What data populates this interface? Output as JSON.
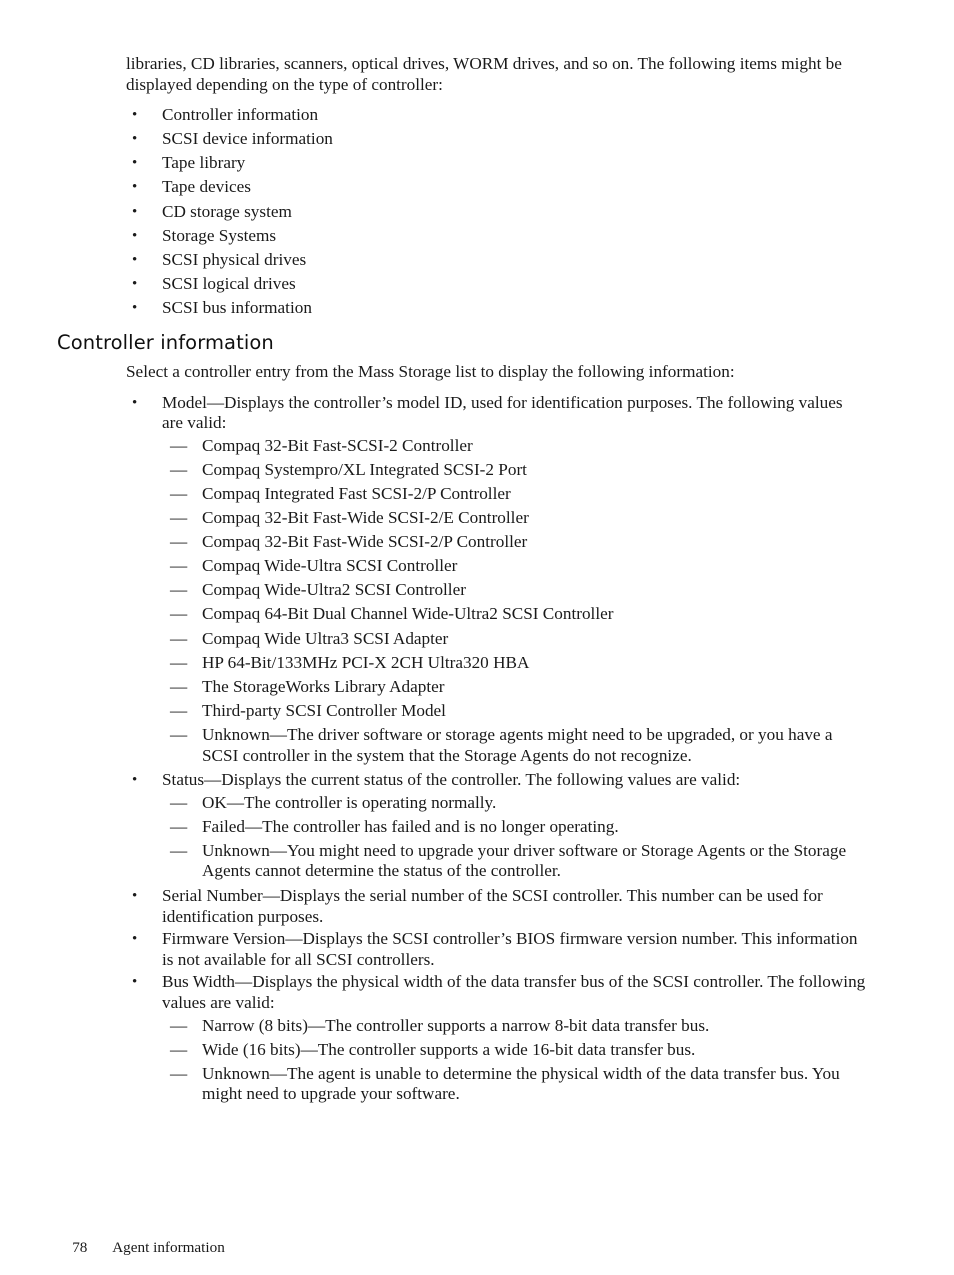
{
  "page": {
    "intro_paragraph": "libraries, CD libraries, scanners, optical drives, WORM drives, and so on. The following items might be displayed depending on the type of controller:",
    "intro_items": [
      "Controller information",
      "SCSI device information",
      "Tape library",
      "Tape devices",
      "CD storage system",
      "Storage Systems",
      "SCSI physical drives",
      "SCSI logical drives",
      "SCSI bus information"
    ],
    "heading": "Controller information",
    "lead_paragraph": "Select a controller entry from the Mass Storage list to display the following information:",
    "bullets": [
      {
        "text": "Model—Displays the controller’s model ID, used for identification purposes. The following values are valid:",
        "subitems": [
          "Compaq 32-Bit Fast-SCSI-2 Controller",
          "Compaq Systempro/XL Integrated SCSI-2 Port",
          "Compaq Integrated Fast SCSI-2/P Controller",
          "Compaq 32-Bit Fast-Wide SCSI-2/E Controller",
          "Compaq 32-Bit Fast-Wide SCSI-2/P Controller",
          "Compaq Wide-Ultra SCSI Controller",
          "Compaq Wide-Ultra2 SCSI Controller",
          "Compaq 64-Bit Dual Channel Wide-Ultra2 SCSI Controller",
          "Compaq Wide Ultra3 SCSI Adapter",
          "HP 64-Bit/133MHz PCI-X 2CH Ultra320 HBA",
          "The StorageWorks Library Adapter",
          "Third-party SCSI Controller Model",
          "Unknown—The driver software or storage agents might need to be upgraded, or you have a SCSI controller in the system that the Storage Agents do not recognize."
        ]
      },
      {
        "text": "Status—Displays the current status of the controller. The following values are valid:",
        "subitems": [
          "OK—The controller is operating normally.",
          "Failed—The controller has failed and is no longer operating.",
          "Unknown—You might need to upgrade your driver software or Storage Agents or the Storage Agents cannot determine the status of the controller."
        ]
      },
      {
        "text": "Serial Number—Displays the serial number of the SCSI controller. This number can be used for identification purposes.",
        "subitems": []
      },
      {
        "text": "Firmware Version—Displays the SCSI controller’s BIOS firmware version number. This information is not available for all SCSI controllers.",
        "subitems": []
      },
      {
        "text": "Bus Width—Displays the physical width of the data transfer bus of the SCSI controller. The following values are valid:",
        "subitems": [
          "Narrow (8 bits)—The controller supports a narrow 8-bit data transfer bus.",
          "Wide (16 bits)—The controller supports a wide 16-bit data transfer bus.",
          "Unknown—The agent is unable to determine the physical width of the data transfer bus. You might need to upgrade your software."
        ]
      }
    ],
    "bullet_glyph": "•",
    "dash_glyph": "—",
    "footer": {
      "page_number": "78",
      "chapter": "Agent information"
    }
  }
}
